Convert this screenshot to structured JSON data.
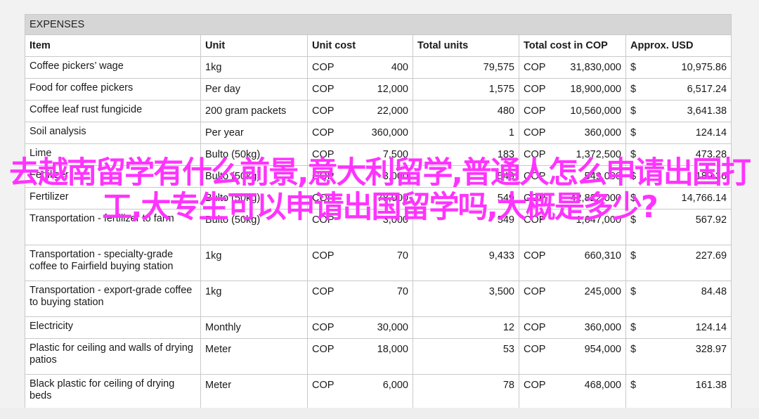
{
  "sheet_title": "EXPENSES",
  "headers": [
    "Item",
    "Unit",
    "Unit cost",
    "Total units",
    "Total cost in COP",
    "Approx. USD"
  ],
  "rows": [
    {
      "item": "Coffee pickers’ wage",
      "unit": "1kg",
      "uc_cur": "COP",
      "uc_val": "400",
      "total_units": "79,575",
      "tc_cur": "COP",
      "tc_val": "31,830,000",
      "usd_cur": "$",
      "usd_val": "10,975.86"
    },
    {
      "item": "Food for coffee pickers",
      "unit": "Per day",
      "uc_cur": "COP",
      "uc_val": "12,000",
      "total_units": "1,575",
      "tc_cur": "COP",
      "tc_val": "18,900,000",
      "usd_cur": "$",
      "usd_val": "6,517.24"
    },
    {
      "item": "Coffee leaf rust fungicide",
      "unit": "200 gram packets",
      "uc_cur": "COP",
      "uc_val": "22,000",
      "total_units": "480",
      "tc_cur": "COP",
      "tc_val": "10,560,000",
      "usd_cur": "$",
      "usd_val": "3,641.38"
    },
    {
      "item": "Soil analysis",
      "unit": "Per year",
      "uc_cur": "COP",
      "uc_val": "360,000",
      "total_units": "1",
      "tc_cur": "COP",
      "tc_val": "360,000",
      "usd_cur": "$",
      "usd_val": "124.14"
    },
    {
      "item": "Lime",
      "unit": "Bulto (50kg)",
      "uc_cur": "COP",
      "uc_val": "7,500",
      "total_units": "183",
      "tc_cur": "COP",
      "tc_val": "1,372,500",
      "usd_cur": "$",
      "usd_val": "473.28"
    },
    {
      "item": "Fertilizer",
      "unit": "Bulto (50kg)",
      "uc_cur": "COP",
      "uc_val": "3,000",
      "total_units": "549",
      "tc_cur": "COP",
      "tc_val": "549,000",
      "usd_cur": "$",
      "usd_val": "189.36"
    },
    {
      "item": "Fertilizer",
      "unit": "Bulto (50kg)",
      "uc_cur": "COP",
      "uc_val": "78,000",
      "total_units": "549",
      "tc_cur": "COP",
      "tc_val": "42,822,000",
      "usd_cur": "$",
      "usd_val": "14,766.14"
    },
    {
      "item": "Transportation - fertilizer to farm",
      "unit": "Bulto (50kg)",
      "uc_cur": "COP",
      "uc_val": "3,000",
      "total_units": "549",
      "tc_cur": "COP",
      "tc_val": "1,647,000",
      "usd_cur": "$",
      "usd_val": "567.92"
    },
    {
      "item": "Transportation - specialty-grade coffee to Fairfield buying station",
      "unit": "1kg",
      "uc_cur": "COP",
      "uc_val": "70",
      "total_units": "9,433",
      "tc_cur": "COP",
      "tc_val": "660,310",
      "usd_cur": "$",
      "usd_val": "227.69"
    },
    {
      "item": "Transportation - export-grade coffee to buying station",
      "unit": "1kg",
      "uc_cur": "COP",
      "uc_val": "70",
      "total_units": "3,500",
      "tc_cur": "COP",
      "tc_val": "245,000",
      "usd_cur": "$",
      "usd_val": "84.48"
    },
    {
      "item": "Electricity",
      "unit": "Monthly",
      "uc_cur": "COP",
      "uc_val": "30,000",
      "total_units": "12",
      "tc_cur": "COP",
      "tc_val": "360,000",
      "usd_cur": "$",
      "usd_val": "124.14"
    },
    {
      "item": "Plastic for ceiling and walls of drying patios",
      "unit": "Meter",
      "uc_cur": "COP",
      "uc_val": "18,000",
      "total_units": "53",
      "tc_cur": "COP",
      "tc_val": "954,000",
      "usd_cur": "$",
      "usd_val": "328.97"
    },
    {
      "item": "Black plastic for ceiling of drying beds",
      "unit": "Meter",
      "uc_cur": "COP",
      "uc_val": "6,000",
      "total_units": "78",
      "tc_cur": "COP",
      "tc_val": "468,000",
      "usd_cur": "$",
      "usd_val": "161.38"
    }
  ],
  "overlay_text": "去越南留学有什么前景,意大利留学,普通人怎么申请出国打工,大专生可以申请出国留学吗,大概是多少?",
  "colors": {
    "overlay": "#ff33ff",
    "title_bar": "#d6d6d6",
    "grid": "#c9c9c9"
  }
}
